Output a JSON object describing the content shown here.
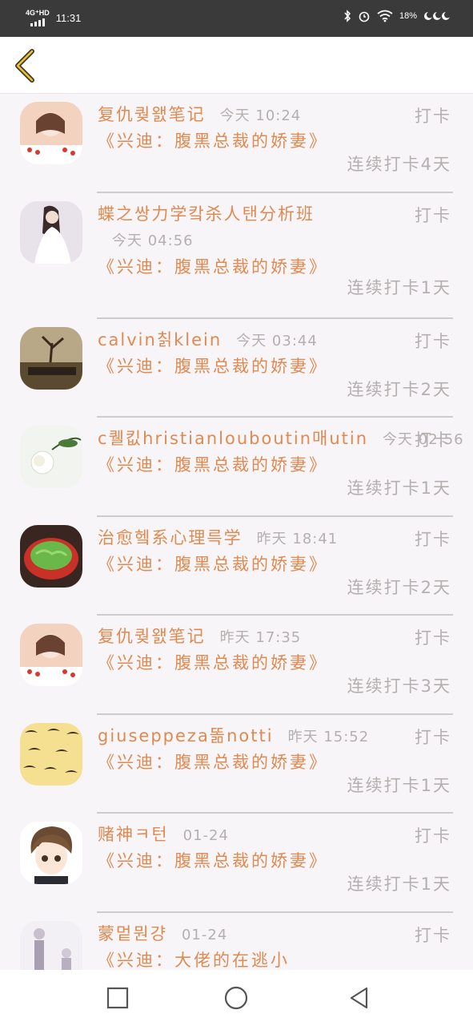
{
  "status_bar": {
    "network": "4G⁺HD",
    "time": "11:31",
    "battery": "18%",
    "icons": [
      "signal-icon",
      "bluetooth-icon",
      "alarm-icon",
      "wifi-icon",
      "moon-icon"
    ]
  },
  "header": {
    "back_icon": "chevron-left-icon",
    "accent_color": "#e08a52"
  },
  "list": {
    "items": [
      {
        "name": "复仇퀒왨笔记",
        "time": "今天 10:24",
        "book": "《兴迪：腹黑总裁的娇妻》",
        "checkin": "打卡",
        "streak": "连续打卡4天",
        "avatar": "avatar-photo-woman"
      },
      {
        "name": "蝶之쌍力学캌杀人탠分析班",
        "time": "今天 04:56",
        "book": "《兴迪：腹黑总裁的娇妻》",
        "checkin": "打卡",
        "streak": "连续打卡1天",
        "avatar": "avatar-photo-bride"
      },
      {
        "name": "calvin칡klein",
        "time": "今天 03:44",
        "book": "《兴迪：腹黑总裁的娇妻》",
        "checkin": "打卡",
        "streak": "连续打卡2天",
        "avatar": "avatar-photo-tree"
      },
      {
        "name": "c퀠킶hristianlouboutin매utin",
        "time": "今天 02:56",
        "book": "《兴迪：腹黑总裁的娇妻》",
        "checkin": "打卡",
        "streak": "连续打卡1天",
        "avatar": "avatar-photo-flower"
      },
      {
        "name": "治愈헼系心理륵学",
        "time": "昨天 18:41",
        "book": "《兴迪：腹黑总裁的娇妻》",
        "checkin": "打卡",
        "streak": "连续打卡2天",
        "avatar": "avatar-photo-salad"
      },
      {
        "name": "复仇퀒왨笔记",
        "time": "昨天 17:35",
        "book": "《兴迪：腹黑总裁的娇妻》",
        "checkin": "打卡",
        "streak": "连续打卡3天",
        "avatar": "avatar-photo-woman"
      },
      {
        "name": "giuseppeza똚notti",
        "time": "昨天 15:52",
        "book": "《兴迪：腹黑总裁的娇妻》",
        "checkin": "打卡",
        "streak": "连续打卡1天",
        "avatar": "avatar-mustache-pattern"
      },
      {
        "name": "赌神ㅋ턴",
        "time": "01-24",
        "book": "《兴迪：腹黑总裁的娇妻》",
        "checkin": "打卡",
        "streak": "连续打卡1天",
        "avatar": "avatar-anime-boy"
      },
      {
        "name": "蒙멑뭔걍",
        "time": "01-24",
        "book": "《兴迪：大佬的在逃小",
        "checkin": "打卡",
        "streak": "",
        "avatar": "avatar-photo-couple"
      }
    ]
  },
  "nav_bar": {
    "icons": [
      "recent-apps-icon",
      "home-icon",
      "back-triangle-icon"
    ]
  }
}
